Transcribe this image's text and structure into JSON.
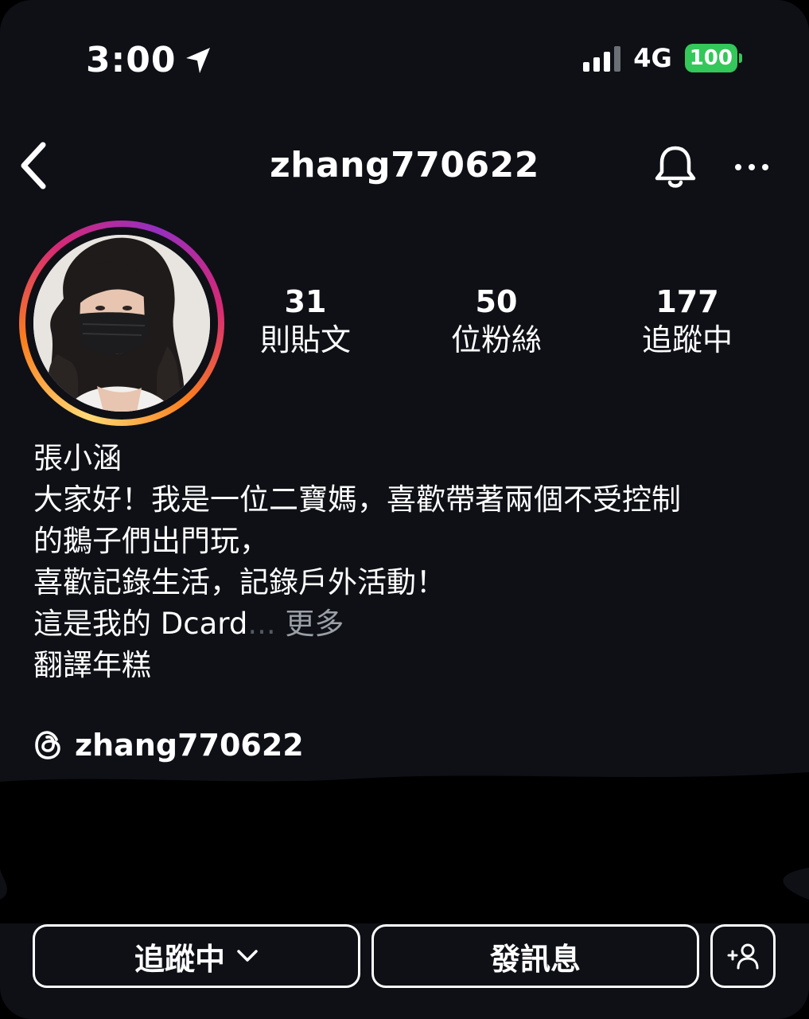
{
  "status_bar": {
    "time": "3:00",
    "network": "4G",
    "battery": "100",
    "battery_color": "#34c759"
  },
  "header": {
    "username": "zhang770622",
    "back_icon": "chevron-left-icon",
    "bell_icon": "bell-icon",
    "more_icon": "ellipsis-icon"
  },
  "stats": [
    {
      "count": "31",
      "label": "則貼文"
    },
    {
      "count": "50",
      "label": "位粉絲"
    },
    {
      "count": "177",
      "label": "追蹤中"
    }
  ],
  "bio": {
    "name": "張小涵",
    "lines": [
      "大家好！我是一位二寶媽，喜歡帶著兩個不受控制",
      "的鵝子們出門玩，",
      "喜歡記錄生活，記錄戶外活動！",
      "這是我的 Dcard"
    ],
    "ellipsis": "...",
    "more": "更多",
    "translate": "翻譯年糕"
  },
  "threads": {
    "handle": "zhang770622",
    "icon": "threads-icon"
  },
  "actions": {
    "following_label": "追蹤中",
    "message_label": "發訊息",
    "add_person_icon": "add-person-icon"
  },
  "colors": {
    "background": "#0e1016",
    "text": "#ffffff",
    "muted": "#9aa0a6"
  }
}
